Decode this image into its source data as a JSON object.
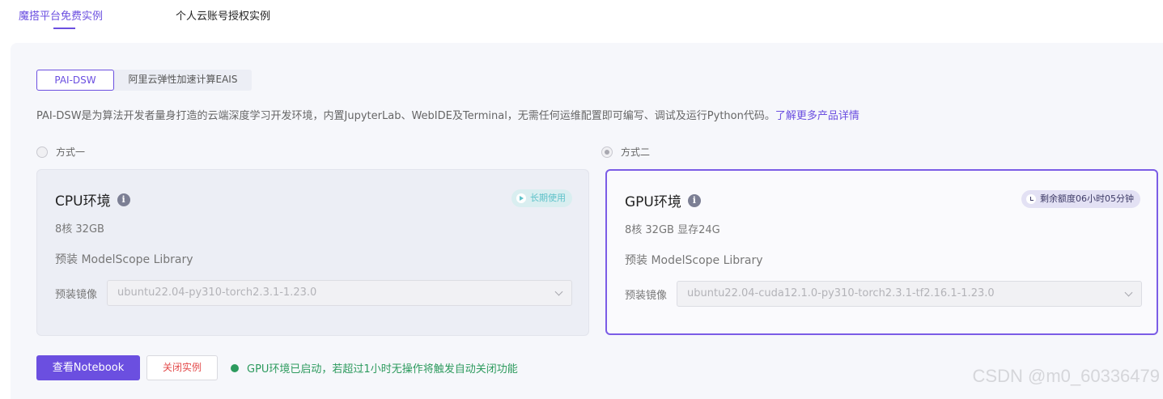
{
  "top_tabs": {
    "active": "魔搭平台免费实例",
    "inactive": "个人云账号授权实例"
  },
  "segment": {
    "pai_dsw": "PAI-DSW",
    "eais": "阿里云弹性加速计算EAIS"
  },
  "description": {
    "text": "PAI-DSW是为算法开发者量身打造的云端深度学习开发环境，内置JupyterLab、WebIDE及Terminal，无需任何运维配置即可编写、调试及运行Python代码。",
    "link": "了解更多产品详情"
  },
  "option_one": {
    "label": "方式一",
    "title": "CPU环境",
    "badge": "长期使用",
    "spec": "8核 32GB",
    "preinstall": "预装 ModelScope Library",
    "image_label": "预装镜像",
    "image_value": "ubuntu22.04-py310-torch2.3.1-1.23.0"
  },
  "option_two": {
    "label": "方式二",
    "title": "GPU环境",
    "badge": "剩余额度06小时05分钟",
    "spec": "8核 32GB 显存24G",
    "preinstall": "预装 ModelScope Library",
    "image_label": "预装镜像",
    "image_value": "ubuntu22.04-cuda12.1.0-py310-torch2.3.1-tf2.16.1-1.23.0"
  },
  "actions": {
    "view_notebook": "查看Notebook",
    "close_instance": "关闭实例",
    "status": "GPU环境已启动，若超过1小时无操作将触发自动关闭功能"
  },
  "watermark": "CSDN @m0_60336479",
  "colors": {
    "accent": "#6b4fe0",
    "success": "#2c9a5d",
    "danger": "#e34b4b"
  }
}
